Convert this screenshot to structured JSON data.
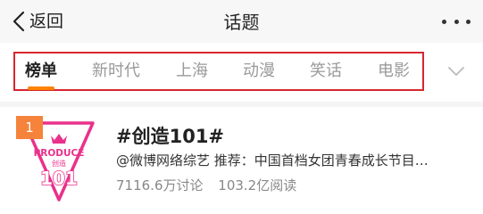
{
  "nav": {
    "back_label": "返回",
    "title": "话题"
  },
  "tabs": [
    {
      "label": "榜单",
      "active": true
    },
    {
      "label": "新时代",
      "active": false
    },
    {
      "label": "上海",
      "active": false
    },
    {
      "label": "动漫",
      "active": false
    },
    {
      "label": "笑话",
      "active": false
    },
    {
      "label": "电影",
      "active": false
    }
  ],
  "topic": {
    "rank": "1",
    "title": "#创造101#",
    "description": "@微博网络综艺 推荐：中国首档女团青春成长节目…",
    "discussions": "7116.6万讨论",
    "reads": "103.2亿阅读",
    "thumbnail": {
      "produce_text": "PRODUCE",
      "chuangzao_text": "创造",
      "number_text": "101"
    }
  },
  "colors": {
    "accent_orange": "#ff8200",
    "rank_badge": "#f5833b",
    "highlight_box": "#d8262f",
    "logo_pink": "#e9318b"
  },
  "icons": {
    "back": "chevron-left-icon",
    "more": "more-dots-icon",
    "expand": "chevron-down-icon"
  }
}
